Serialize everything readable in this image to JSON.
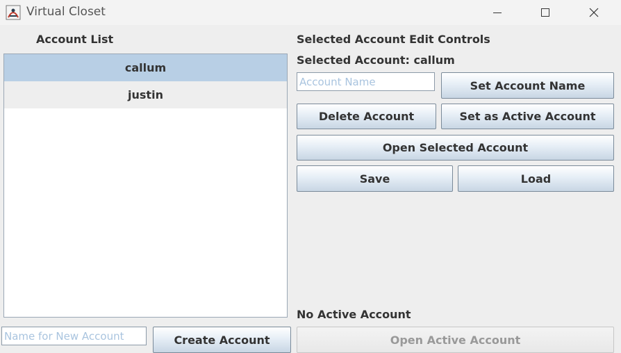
{
  "window": {
    "title": "Virtual Closet"
  },
  "left_panel": {
    "heading": "Account List",
    "accounts": [
      {
        "name": "callum",
        "selected": true
      },
      {
        "name": "justin",
        "selected": false
      }
    ],
    "new_account_placeholder": "Name for New Account",
    "new_account_value": "",
    "create_button": "Create Account"
  },
  "right_panel": {
    "heading": "Selected Account Edit Controls",
    "selected_account_label": "Selected Account: callum",
    "account_name_placeholder": "Account Name",
    "account_name_value": "",
    "set_name_button": "Set Account Name",
    "delete_button": "Delete Account",
    "set_active_button": "Set as Active Account",
    "open_selected_button": "Open Selected Account",
    "save_button": "Save",
    "load_button": "Load",
    "active_status": "No Active Account",
    "open_active_button": "Open Active Account"
  },
  "colors": {
    "selection": "#b8cfe5",
    "placeholder": "#a9c4df",
    "window_bg": "#eeeeee"
  }
}
